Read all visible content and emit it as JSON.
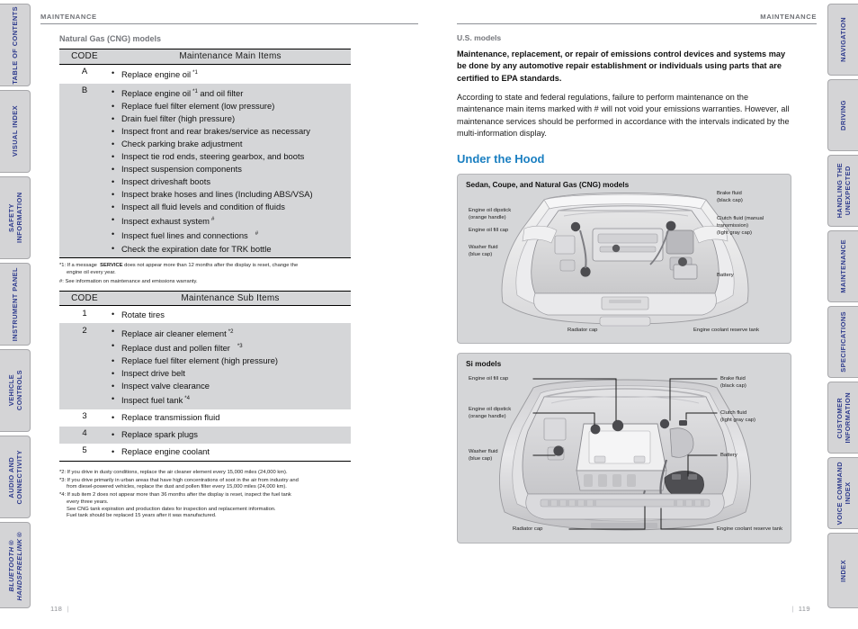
{
  "sidebar_left": {
    "items": [
      {
        "label": "TABLE OF CONTENTS",
        "italic": false
      },
      {
        "label": "VISUAL INDEX",
        "italic": false
      },
      {
        "label": "SAFETY INFORMATION",
        "italic": false
      },
      {
        "label": "INSTRUMENT PANEL",
        "italic": false
      },
      {
        "label": "VEHICLE\nCONTROLS",
        "italic": false
      },
      {
        "label": "AUDIO AND\nCONNECTIVITY",
        "italic": false
      },
      {
        "label": "BLUETOOTH®\nHANDSFREELINK®",
        "italic": true
      }
    ]
  },
  "sidebar_right": {
    "items": [
      {
        "label": "NAVIGATION"
      },
      {
        "label": "DRIVING"
      },
      {
        "label": "HANDLING THE\nUNEXPECTED"
      },
      {
        "label": "MAINTENANCE"
      },
      {
        "label": "SPECIFICATIONS"
      },
      {
        "label": "CUSTOMER\nINFORMATION"
      },
      {
        "label": "VOICE COMMAND\nINDEX"
      },
      {
        "label": "INDEX"
      }
    ]
  },
  "left_page": {
    "running_head": "MAINTENANCE",
    "section_subtitle": "Natural Gas (CNG) models",
    "main_table": {
      "headers": {
        "code": "CODE",
        "items": "Maintenance Main Items"
      },
      "rows": [
        {
          "code": "A",
          "shaded": false,
          "items": [
            {
              "text": "Replace engine oil",
              "footnote": "*1"
            }
          ]
        },
        {
          "code": "B",
          "shaded": true,
          "items": [
            {
              "text": "Replace engine oil",
              "footnote": "*1",
              "suffix": " and oil filter"
            },
            {
              "text": "Replace fuel filter element (low pressure)"
            },
            {
              "text": "Drain fuel filter (high pressure)"
            },
            {
              "text": "Inspect front and rear brakes/service as necessary"
            },
            {
              "text": "Check parking brake adjustment"
            },
            {
              "text": "Inspect tie rod ends, steering gearbox, and boots"
            },
            {
              "text": "Inspect suspension components"
            },
            {
              "text": "Inspect driveshaft boots"
            },
            {
              "text": "Inspect brake hoses and lines (Including ABS/VSA)"
            },
            {
              "text": "Inspect all fluid levels and condition of fluids"
            },
            {
              "text": "Inspect exhaust system",
              "footnote": "#"
            },
            {
              "text": "Inspect fuel lines and connections",
              "footnote": "#",
              "wide": true
            },
            {
              "text": "Check the expiration date for TRK bottle"
            }
          ]
        }
      ]
    },
    "footnotes_main": [
      {
        "marker": "*1:",
        "lead": "If a message",
        "bold": "SERVICE",
        "rest": "does not appear more than 12 months after the display is reset, change the",
        "cont": "engine oil every year."
      },
      {
        "marker": "#",
        "text": ": See information on maintenance and emissions warranty."
      }
    ],
    "sub_table": {
      "headers": {
        "code": "CODE",
        "items": "Maintenance Sub Items"
      },
      "rows": [
        {
          "code": "1",
          "shaded": false,
          "items": [
            {
              "text": "Rotate tires"
            }
          ]
        },
        {
          "code": "2",
          "shaded": true,
          "items": [
            {
              "text": "Replace air cleaner element",
              "footnote": "*2"
            },
            {
              "text": "Replace dust and pollen filter",
              "footnote": "*3",
              "wide": true
            },
            {
              "text": "Replace fuel filter element (high pressure)"
            },
            {
              "text": "Inspect drive belt"
            },
            {
              "text": "Inspect valve clearance"
            },
            {
              "text": "Inspect fuel tank",
              "footnote": "*4"
            }
          ]
        },
        {
          "code": "3",
          "shaded": false,
          "items": [
            {
              "text": "Replace transmission fluid"
            }
          ]
        },
        {
          "code": "4",
          "shaded": true,
          "items": [
            {
              "text": "Replace spark plugs"
            }
          ]
        },
        {
          "code": "5",
          "shaded": false,
          "items": [
            {
              "text": "Replace engine coolant"
            }
          ]
        }
      ]
    },
    "footnotes_sub": [
      "*2: If you drive in dusty conditions, replace the air cleaner element every 15,000 miles (24,000 km).",
      "*3: If you drive primarily in urban areas that have high concentrations of soot in the air from industry and\nfrom diesel-powered vehicles, replace the dust and pollen filter every 15,000 miles (24,000 km).",
      "*4: If sub item 2 does not appear more than 36 months after the display is reset, inspect the fuel tank\nevery three years.\nSee CNG tank expiration and production dates for inspection and replacement information.\nFuel tank should be replaced 15 years after it was manufactured."
    ],
    "page_number": "118"
  },
  "right_page": {
    "running_head": "MAINTENANCE",
    "us_models_label": "U.S. models",
    "bold_paragraph": "Maintenance, replacement, or repair of emissions control devices and systems may be done by any automotive repair establishment or individuals using parts that are certified to EPA standards.",
    "body_paragraph": "According to state and federal regulations, failure to perform maintenance on the maintenance main items marked with # will not void your emissions warranties. However, all maintenance services should be performed in accordance with the intervals indicated by the multi-information display.",
    "heading": "Under the Hood",
    "panel_1": {
      "title": "Sedan, Coupe, and Natural Gas (CNG) models",
      "labels": [
        {
          "id": "engine-oil-dipstick",
          "text": "Engine oil dipstick\n(orange handle)"
        },
        {
          "id": "engine-oil-fill-cap",
          "text": "Engine oil fill cap"
        },
        {
          "id": "washer-fluid",
          "text": "Washer fluid\n(blue cap)"
        },
        {
          "id": "brake-fluid",
          "text": "Brake fluid\n(black cap)"
        },
        {
          "id": "clutch-fluid",
          "text": "Clutch fluid (manual\ntransmission)\n(light gray cap)"
        },
        {
          "id": "battery",
          "text": "Battery"
        },
        {
          "id": "radiator-cap",
          "text": "Radiator cap"
        },
        {
          "id": "coolant-reserve",
          "text": "Engine coolant reserve tank"
        }
      ]
    },
    "panel_2": {
      "title": "Si models",
      "labels": [
        {
          "id": "engine-oil-fill-cap",
          "text": "Engine oil fill cap"
        },
        {
          "id": "engine-oil-dipstick",
          "text": "Engine oil dipstick\n(orange handle)"
        },
        {
          "id": "washer-fluid",
          "text": "Washer fluid\n(blue cap)"
        },
        {
          "id": "brake-fluid",
          "text": "Brake fluid\n(black cap)"
        },
        {
          "id": "clutch-fluid",
          "text": "Clutch fluid\n(light gray cap)"
        },
        {
          "id": "battery",
          "text": "Battery"
        },
        {
          "id": "radiator-cap",
          "text": "Radiator cap"
        },
        {
          "id": "coolant-reserve",
          "text": "Engine coolant reserve tank"
        }
      ]
    },
    "page_number": "119"
  },
  "colors": {
    "tab_text": "#2d3a8c",
    "tab_bg": "#d4d4d6",
    "heading_blue": "#1a7fc1",
    "table_shade": "#d5d6d8",
    "muted_text": "#74767b"
  }
}
